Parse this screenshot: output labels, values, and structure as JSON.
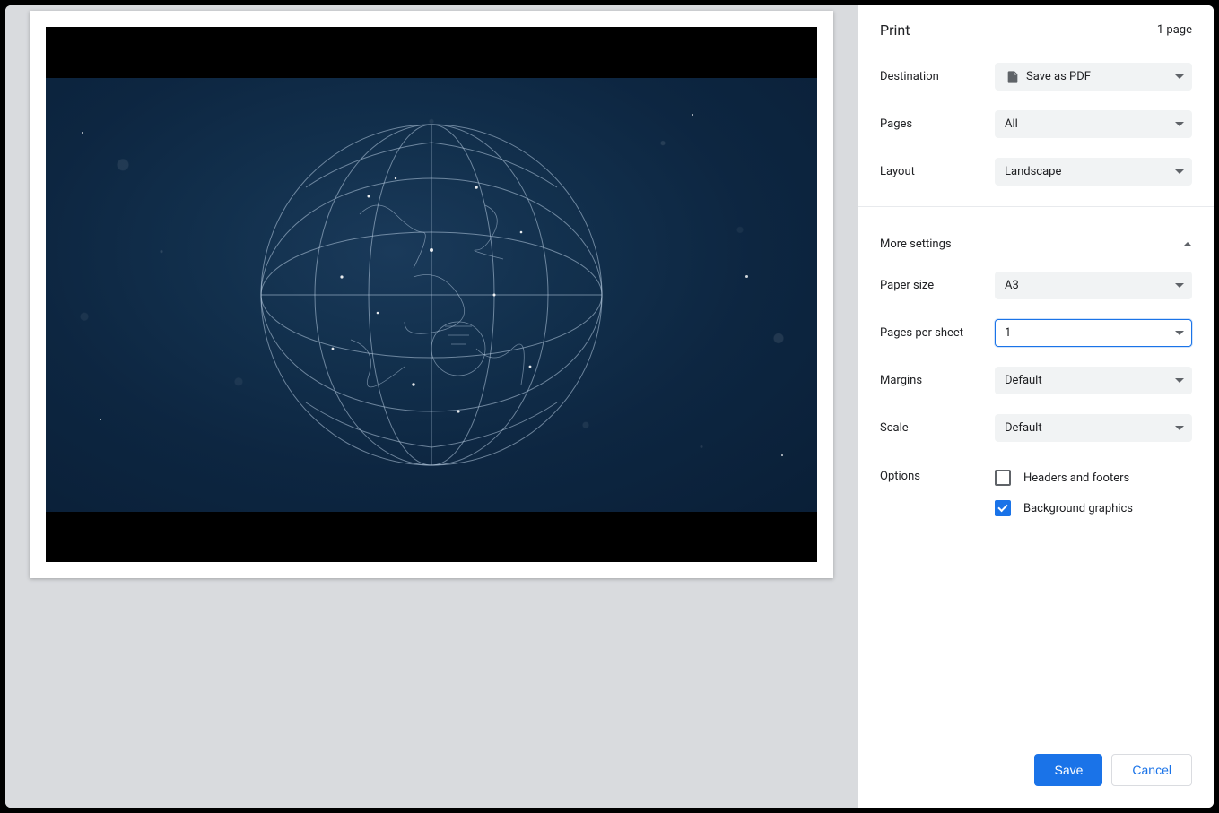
{
  "header": {
    "title": "Print",
    "page_count": "1 page"
  },
  "settings": {
    "destination": {
      "label": "Destination",
      "value": "Save as PDF"
    },
    "pages": {
      "label": "Pages",
      "value": "All"
    },
    "layout": {
      "label": "Layout",
      "value": "Landscape"
    }
  },
  "more_settings": {
    "label": "More settings",
    "paper_size": {
      "label": "Paper size",
      "value": "A3"
    },
    "pages_per_sheet": {
      "label": "Pages per sheet",
      "value": "1"
    },
    "margins": {
      "label": "Margins",
      "value": "Default"
    },
    "scale": {
      "label": "Scale",
      "value": "Default"
    },
    "options": {
      "label": "Options",
      "headers_footers": {
        "label": "Headers and footers",
        "checked": false
      },
      "background_graphics": {
        "label": "Background graphics",
        "checked": true
      }
    }
  },
  "footer": {
    "save": "Save",
    "cancel": "Cancel"
  }
}
